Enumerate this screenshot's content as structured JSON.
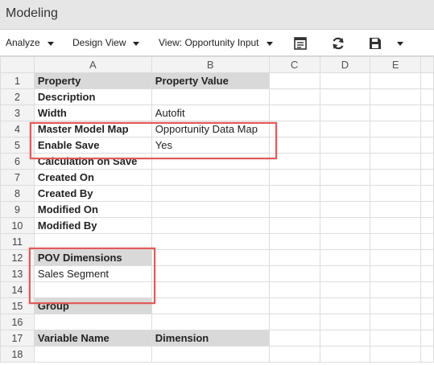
{
  "window": {
    "title": "Modeling"
  },
  "toolbar": {
    "analyze_label": "Analyze",
    "design_view_label": "Design View",
    "view_label": "View: Opportunity Input",
    "icons": [
      "spreadsheet-icon",
      "refresh-icon",
      "save-icon",
      "chevron-down-icon"
    ]
  },
  "columns": [
    "A",
    "B",
    "C",
    "D",
    "E"
  ],
  "rows": [
    {
      "num": "1",
      "a": "Property",
      "b": "Property Value"
    },
    {
      "num": "2",
      "a": "Description",
      "b": ""
    },
    {
      "num": "3",
      "a": "Width",
      "b": "Autofit"
    },
    {
      "num": "4",
      "a": "Master Model Map",
      "b": "Opportunity Data Map"
    },
    {
      "num": "5",
      "a": "Enable Save",
      "b": "Yes"
    },
    {
      "num": "6",
      "a": "Calculation on Save",
      "b": ""
    },
    {
      "num": "7",
      "a": "Created On",
      "b": ""
    },
    {
      "num": "8",
      "a": "Created By",
      "b": ""
    },
    {
      "num": "9",
      "a": "Modified On",
      "b": ""
    },
    {
      "num": "10",
      "a": "Modified By",
      "b": ""
    },
    {
      "num": "11",
      "a": "",
      "b": ""
    },
    {
      "num": "12",
      "a": "POV Dimensions",
      "b": ""
    },
    {
      "num": "13",
      "a": "Sales Segment",
      "b": ""
    },
    {
      "num": "14",
      "a": "",
      "b": ""
    },
    {
      "num": "15",
      "a": "Group",
      "b": ""
    },
    {
      "num": "16",
      "a": "",
      "b": ""
    },
    {
      "num": "17",
      "a": "Variable Name",
      "b": "Dimension"
    },
    {
      "num": "18",
      "a": "",
      "b": ""
    }
  ],
  "colors": {
    "highlight_border": "#e05a5a",
    "header_fill": "#d9d9d9"
  }
}
